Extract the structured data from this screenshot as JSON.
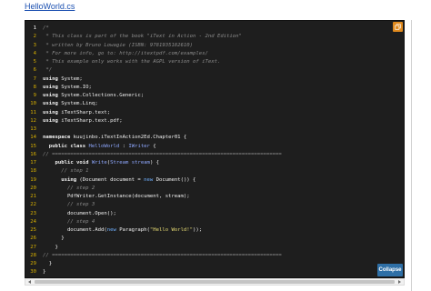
{
  "file_link": "HelloWorld.cs",
  "buttons": {
    "collapse_label": "Collapse",
    "copy_icon": "copy-icon"
  },
  "colors": {
    "code_background": "#1e1e1e",
    "line_number": "#d8b000",
    "comment": "#8a8a8a",
    "type": "#8fa8ff",
    "string": "#e6db74",
    "collapse_button": "#2e6fa6",
    "copy_button": "#e08a1e"
  },
  "code": {
    "lines": [
      {
        "n": "1",
        "parts": [
          [
            "comment",
            "/*"
          ]
        ]
      },
      {
        "n": "2",
        "parts": [
          [
            "comment",
            " * This class is part of the book \"iText in Action - 2nd Edition\""
          ]
        ]
      },
      {
        "n": "3",
        "parts": [
          [
            "comment",
            " * written by Bruno Lowagie (ISBN: 9781935182610)"
          ]
        ]
      },
      {
        "n": "4",
        "parts": [
          [
            "comment",
            " * For more info, go to: http://itextpdf.com/examples/"
          ]
        ]
      },
      {
        "n": "5",
        "parts": [
          [
            "comment",
            " * This example only works with the AGPL version of iText."
          ]
        ]
      },
      {
        "n": "6",
        "parts": [
          [
            "comment",
            " */"
          ]
        ]
      },
      {
        "n": "7",
        "parts": [
          [
            "kw",
            "using"
          ],
          [
            "plain",
            " System;"
          ]
        ]
      },
      {
        "n": "8",
        "parts": [
          [
            "kw",
            "using"
          ],
          [
            "plain",
            " System.IO;"
          ]
        ]
      },
      {
        "n": "9",
        "parts": [
          [
            "kw",
            "using"
          ],
          [
            "plain",
            " System.Collections.Generic;"
          ]
        ]
      },
      {
        "n": "10",
        "parts": [
          [
            "kw",
            "using"
          ],
          [
            "plain",
            " System.Linq;"
          ]
        ]
      },
      {
        "n": "11",
        "parts": [
          [
            "kw",
            "using"
          ],
          [
            "plain",
            " iTextSharp.text;"
          ]
        ]
      },
      {
        "n": "12",
        "parts": [
          [
            "kw",
            "using"
          ],
          [
            "plain",
            " iTextSharp.text.pdf;"
          ]
        ]
      },
      {
        "n": "13",
        "parts": [
          [
            "plain",
            ""
          ]
        ]
      },
      {
        "n": "14",
        "parts": [
          [
            "kw",
            "namespace"
          ],
          [
            "plain",
            " kuujinbo.iTextInAction2Ed.Chapter01 {"
          ]
        ]
      },
      {
        "n": "15",
        "parts": [
          [
            "plain",
            "  "
          ],
          [
            "kw",
            "public class"
          ],
          [
            "plain",
            " "
          ],
          [
            "type",
            "HelloWorld"
          ],
          [
            "plain",
            " : "
          ],
          [
            "type",
            "IWriter"
          ],
          [
            "plain",
            " {"
          ]
        ]
      },
      {
        "n": "16",
        "parts": [
          [
            "comment",
            "// ==========================================================================="
          ]
        ]
      },
      {
        "n": "17",
        "parts": [
          [
            "plain",
            "    "
          ],
          [
            "kw",
            "public void"
          ],
          [
            "plain",
            " "
          ],
          [
            "type",
            "Write"
          ],
          [
            "plain",
            "("
          ],
          [
            "type",
            "Stream"
          ],
          [
            "plain",
            " "
          ],
          [
            "type",
            "stream"
          ],
          [
            "plain",
            ") {"
          ]
        ]
      },
      {
        "n": "18",
        "parts": [
          [
            "plain",
            "      "
          ],
          [
            "comment",
            "// step 1"
          ]
        ]
      },
      {
        "n": "19",
        "parts": [
          [
            "plain",
            "      "
          ],
          [
            "kw",
            "using"
          ],
          [
            "plain",
            " (Document document = "
          ],
          [
            "blue",
            "new"
          ],
          [
            "plain",
            " Document()) {"
          ]
        ]
      },
      {
        "n": "20",
        "parts": [
          [
            "plain",
            "        "
          ],
          [
            "comment",
            "// step 2"
          ]
        ]
      },
      {
        "n": "21",
        "parts": [
          [
            "plain",
            "        PdfWriter.GetInstance(document, stream);"
          ]
        ]
      },
      {
        "n": "22",
        "parts": [
          [
            "plain",
            "        "
          ],
          [
            "comment",
            "// step 3"
          ]
        ]
      },
      {
        "n": "23",
        "parts": [
          [
            "plain",
            "        document.Open();"
          ]
        ]
      },
      {
        "n": "24",
        "parts": [
          [
            "plain",
            "        "
          ],
          [
            "comment",
            "// step 4"
          ]
        ]
      },
      {
        "n": "25",
        "parts": [
          [
            "plain",
            "        document.Add("
          ],
          [
            "blue",
            "new"
          ],
          [
            "plain",
            " Paragraph("
          ],
          [
            "str",
            "\"Hello World!\""
          ],
          [
            "plain",
            "));"
          ]
        ]
      },
      {
        "n": "26",
        "parts": [
          [
            "plain",
            "      }"
          ]
        ]
      },
      {
        "n": "27",
        "parts": [
          [
            "plain",
            "    }"
          ]
        ]
      },
      {
        "n": "28",
        "parts": [
          [
            "comment",
            "// ==========================================================================="
          ]
        ]
      },
      {
        "n": "29",
        "parts": [
          [
            "plain",
            "  }"
          ]
        ]
      },
      {
        "n": "30",
        "parts": [
          [
            "plain",
            "}"
          ]
        ]
      }
    ]
  }
}
